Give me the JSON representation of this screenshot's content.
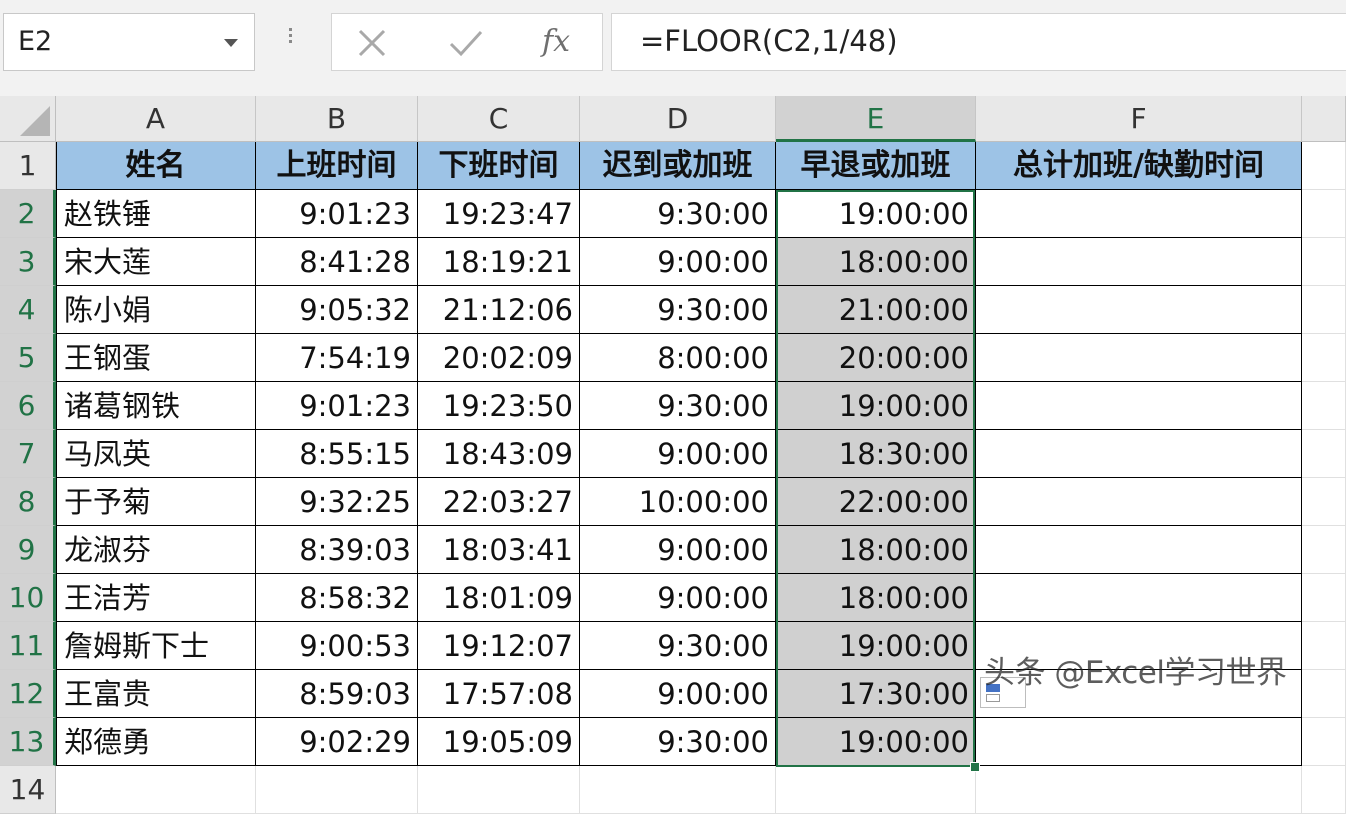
{
  "name_box": {
    "value": "E2"
  },
  "formula_bar": {
    "cancel_icon": "close-icon",
    "enter_icon": "check-icon",
    "fx_label": "fx",
    "formula": "=FLOOR(C2,1/48)"
  },
  "columns": [
    "A",
    "B",
    "C",
    "D",
    "E",
    "F"
  ],
  "row_numbers": [
    "1",
    "2",
    "3",
    "4",
    "5",
    "6",
    "7",
    "8",
    "9",
    "10",
    "11",
    "12",
    "13",
    "14"
  ],
  "table": {
    "headers": [
      "姓名",
      "上班时间",
      "下班时间",
      "迟到或加班",
      "早退或加班",
      "总计加班/缺勤时间"
    ],
    "rows": [
      [
        "赵铁锤",
        "9:01:23",
        "19:23:47",
        "9:30:00",
        "19:00:00",
        ""
      ],
      [
        "宋大莲",
        "8:41:28",
        "18:19:21",
        "9:00:00",
        "18:00:00",
        ""
      ],
      [
        "陈小娟",
        "9:05:32",
        "21:12:06",
        "9:30:00",
        "21:00:00",
        ""
      ],
      [
        "王钢蛋",
        "7:54:19",
        "20:02:09",
        "8:00:00",
        "20:00:00",
        ""
      ],
      [
        "诸葛钢铁",
        "9:01:23",
        "19:23:50",
        "9:30:00",
        "19:00:00",
        ""
      ],
      [
        "马凤英",
        "8:55:15",
        "18:43:09",
        "9:00:00",
        "18:30:00",
        ""
      ],
      [
        "于予菊",
        "9:32:25",
        "22:03:27",
        "10:00:00",
        "22:00:00",
        ""
      ],
      [
        "龙淑芬",
        "8:39:03",
        "18:03:41",
        "9:00:00",
        "18:00:00",
        ""
      ],
      [
        "王洁芳",
        "8:58:32",
        "18:01:09",
        "9:00:00",
        "18:00:00",
        ""
      ],
      [
        "詹姆斯下士",
        "9:00:53",
        "19:12:07",
        "9:30:00",
        "19:00:00",
        ""
      ],
      [
        "王富贵",
        "8:59:03",
        "17:57:08",
        "9:00:00",
        "17:30:00",
        ""
      ],
      [
        "郑德勇",
        "9:02:29",
        "19:05:09",
        "9:30:00",
        "19:00:00",
        ""
      ]
    ]
  },
  "selection": {
    "active_cell": "E2",
    "range": "E2:E13"
  },
  "colors": {
    "header_fill": "#9dc3e6",
    "selection_border": "#217346",
    "selection_fill": "#d0d0d0"
  },
  "watermark": "头条 @Excel学习世界"
}
